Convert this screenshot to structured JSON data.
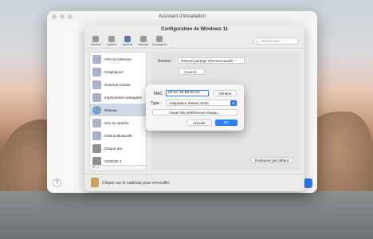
{
  "installer": {
    "title": "Assistant d'installation"
  },
  "config": {
    "title": "Configuration de Windows 11",
    "toolbar": [
      {
        "label": "Général",
        "icon": "general-icon"
      },
      {
        "label": "Options",
        "icon": "options-icon"
      },
      {
        "label": "Matériel",
        "icon": "hardware-icon"
      },
      {
        "label": "Sécurité",
        "icon": "security-icon"
      },
      {
        "label": "Sauvegarde",
        "icon": "backup-icon"
      }
    ],
    "search_placeholder": "Rechercher",
    "sidebar": [
      {
        "label": "CPU et mémoire"
      },
      {
        "label": "Graphiques"
      },
      {
        "label": "Souris & Clavier"
      },
      {
        "label": "Imprimantes partagées"
      },
      {
        "label": "Réseau"
      },
      {
        "label": "Son et caméra"
      },
      {
        "label": "USB & Bluetooth"
      },
      {
        "label": "Disque dur"
      },
      {
        "label": "CD/DVD 1"
      }
    ],
    "sidebar_footer": "+  −",
    "source_label": "Source :",
    "source_value": "Réseau partagé (Recommandé)  ⌃",
    "advanced_label": "Avancé...",
    "restore_label": "Restaurer par défaut",
    "lock_text": "Cliquer sur le cadenas pour verrouiller."
  },
  "dialog": {
    "mac_label": "MAC :",
    "mac_value": "00:1C:42:65:20:4A",
    "generate_label": "Générer",
    "type_label": "Type :",
    "type_value": "Adaptateur réseau VirtIo",
    "prefs_label": "Ouvrir les préférences réseau...",
    "cancel_label": "Annuler",
    "ok_label": "OK"
  },
  "help": "?"
}
